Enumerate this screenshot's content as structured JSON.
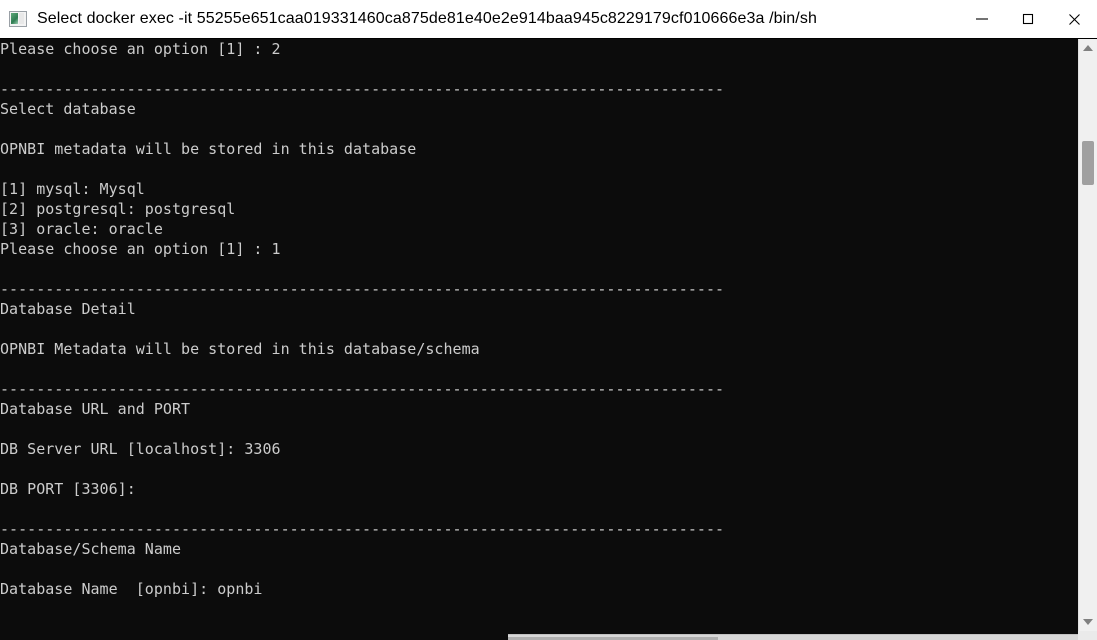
{
  "window": {
    "title": "Select docker  exec -it 55255e651caa019331460ca875de81e40e2e914baa945c8229179cf010666e3a /bin/sh",
    "icon": "console-window-icon",
    "minimize_label": "—",
    "maximize_label": "☐",
    "close_label": "✕",
    "colors": {
      "titlebar_background": "#ffffff",
      "titlebar_text": "#000000",
      "terminal_background": "#0c0c0c",
      "terminal_text": "#cccccc",
      "scrollbar_track": "#f0f0f0",
      "scrollbar_thumb": "#a0a0a0",
      "scrollbar_arrow": "#808080"
    }
  },
  "terminal": {
    "separator": "--------------------------------------------------------------------------------",
    "lines": [
      "Please choose an option [1] : 2",
      "",
      "--------------------------------------------------------------------------------",
      "Select database",
      "",
      "OPNBI metadata will be stored in this database",
      "",
      "[1] mysql: Mysql",
      "[2] postgresql: postgresql",
      "[3] oracle: oracle",
      "Please choose an option [1] : 1",
      "",
      "--------------------------------------------------------------------------------",
      "Database Detail",
      "",
      "OPNBI Metadata will be stored in this database/schema",
      "",
      "--------------------------------------------------------------------------------",
      "Database URL and PORT",
      "",
      "DB Server URL [localhost]: 3306",
      "",
      "DB PORT [3306]:",
      "",
      "--------------------------------------------------------------------------------",
      "Database/Schema Name",
      "",
      "Database Name  [opnbi]: opnbi"
    ],
    "prompts": [
      {
        "label": "Please choose an option",
        "default": "[1]",
        "answer": "2"
      },
      {
        "label": "Please choose an option",
        "default": "[1]",
        "answer": "1"
      },
      {
        "label": "DB Server URL",
        "default": "[localhost]",
        "answer": "3306"
      },
      {
        "label": "DB PORT",
        "default": "[3306]",
        "answer": ""
      },
      {
        "label": "Database Name",
        "default": "[opnbi]",
        "answer": "opnbi"
      }
    ],
    "sections": [
      "Select database",
      "Database Detail",
      "Database URL and PORT",
      "Database/Schema Name"
    ],
    "menu_options": [
      "[1] mysql: Mysql",
      "[2] postgresql: postgresql",
      "[3] oracle: oracle"
    ]
  },
  "scrollbars": {
    "vertical": {
      "up_arrow": "scroll-up-arrow",
      "down_arrow": "scroll-down-arrow",
      "thumb_position_percent": 18
    },
    "horizontal": {
      "thumb_position_percent": 52
    }
  }
}
